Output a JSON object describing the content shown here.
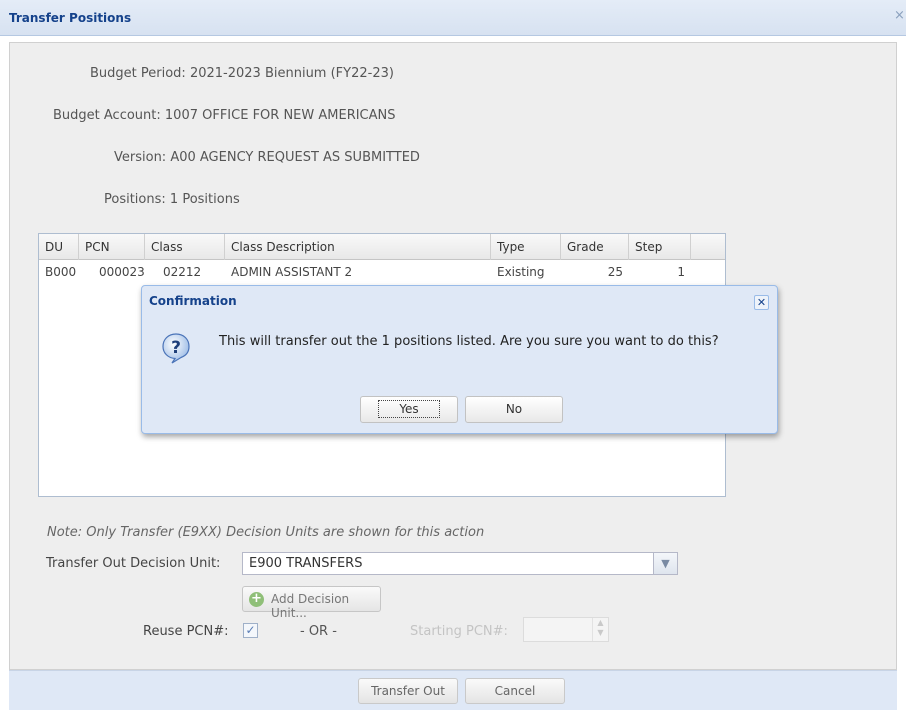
{
  "window": {
    "title": "Transfer Positions",
    "close_glyph": "×"
  },
  "info": {
    "budget_period_label": "Budget Period:",
    "budget_period_value": "2021-2023 Biennium (FY22-23)",
    "budget_account_label": "Budget Account:",
    "budget_account_value": "1007 OFFICE FOR NEW AMERICANS",
    "version_label": "Version:",
    "version_value": "A00 AGENCY REQUEST AS SUBMITTED",
    "positions_label": "Positions:",
    "positions_value": "1 Positions"
  },
  "grid": {
    "columns": [
      "DU",
      "PCN",
      "Class",
      "Class Description",
      "Type",
      "Grade",
      "Step"
    ],
    "rows": [
      {
        "du": "B000",
        "pcn": "000023",
        "class": "02212",
        "class_description": "ADMIN ASSISTANT 2",
        "type": "Existing",
        "grade": "25",
        "step": "1"
      }
    ]
  },
  "form": {
    "note": "Note: Only Transfer (E9XX) Decision Units are shown for this action",
    "decision_unit_label": "Transfer Out Decision Unit:",
    "decision_unit_value": "E900 TRANSFERS",
    "add_decision_unit_label": "Add Decision Unit...",
    "reuse_pcn_label": "Reuse PCN#:",
    "reuse_pcn_checked": true,
    "or_label": "- OR -",
    "starting_pcn_label": "Starting PCN#:",
    "starting_pcn_value": ""
  },
  "footer": {
    "transfer_out_label": "Transfer Out",
    "cancel_label": "Cancel"
  },
  "confirmation": {
    "title": "Confirmation",
    "message": "This will transfer out the 1 positions listed. Are you sure you want to do this?",
    "yes_label": "Yes",
    "no_label": "No",
    "icon": "question-icon"
  },
  "colors": {
    "header_title": "#15428b",
    "dialog_bg": "#dfe8f6",
    "dialog_border": "#99bbe8"
  }
}
